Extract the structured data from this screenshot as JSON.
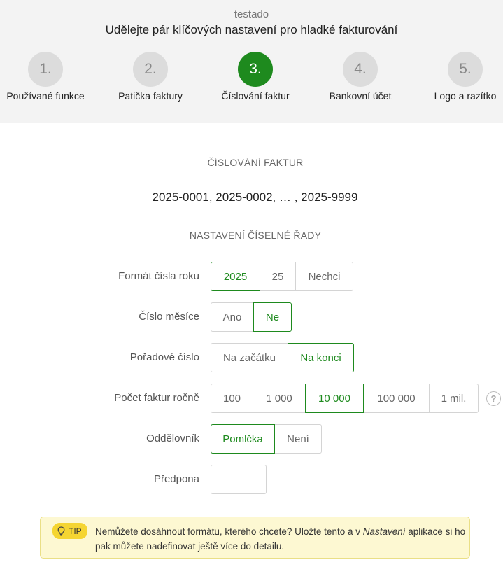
{
  "header": {
    "company": "testado",
    "title": "Udělejte pár klíčových nastavení pro hladké fakturování"
  },
  "steps": [
    {
      "number": "1.",
      "label": "Používané funkce",
      "active": false
    },
    {
      "number": "2.",
      "label": "Patička faktury",
      "active": false
    },
    {
      "number": "3.",
      "label": "Číslování faktur",
      "active": true
    },
    {
      "number": "4.",
      "label": "Bankovní účet",
      "active": false
    },
    {
      "number": "5.",
      "label": "Logo a razítko",
      "active": false
    }
  ],
  "numbering": {
    "section_title": "ČÍSLOVÁNÍ FAKTUR",
    "example": "2025-0001, 2025-0002, … , 2025-9999"
  },
  "series": {
    "section_title": "NASTAVENÍ ČÍSELNÉ ŘADY",
    "year_format": {
      "label": "Formát čísla roku",
      "options": [
        "2025",
        "25",
        "Nechci"
      ],
      "selected": "2025"
    },
    "month": {
      "label": "Číslo měsíce",
      "options": [
        "Ano",
        "Ne"
      ],
      "selected": "Ne"
    },
    "order": {
      "label": "Pořadové číslo",
      "options": [
        "Na začátku",
        "Na konci"
      ],
      "selected": "Na konci"
    },
    "count": {
      "label": "Počet faktur ročně",
      "options": [
        "100",
        "1 000",
        "10 000",
        "100 000",
        "1 mil."
      ],
      "selected": "10 000",
      "help": "?"
    },
    "separator": {
      "label": "Oddělovník",
      "options": [
        "Pomlčka",
        "Není"
      ],
      "selected": "Pomlčka"
    },
    "prefix": {
      "label": "Předpona",
      "value": "",
      "placeholder": ""
    }
  },
  "tip": {
    "badge": "TIP",
    "text_before": "Nemůžete dosáhnout formátu, kterého chcete? Uložte tento a v ",
    "text_em": "Nastavení",
    "text_after": " aplikace si ho pak můžete nadefinovat ještě více do detailu."
  },
  "colors": {
    "accent": "#1e8a1e",
    "tip_bg": "#fdf8d2",
    "tip_badge": "#f5d532",
    "header_bg": "#f3f3f3"
  }
}
